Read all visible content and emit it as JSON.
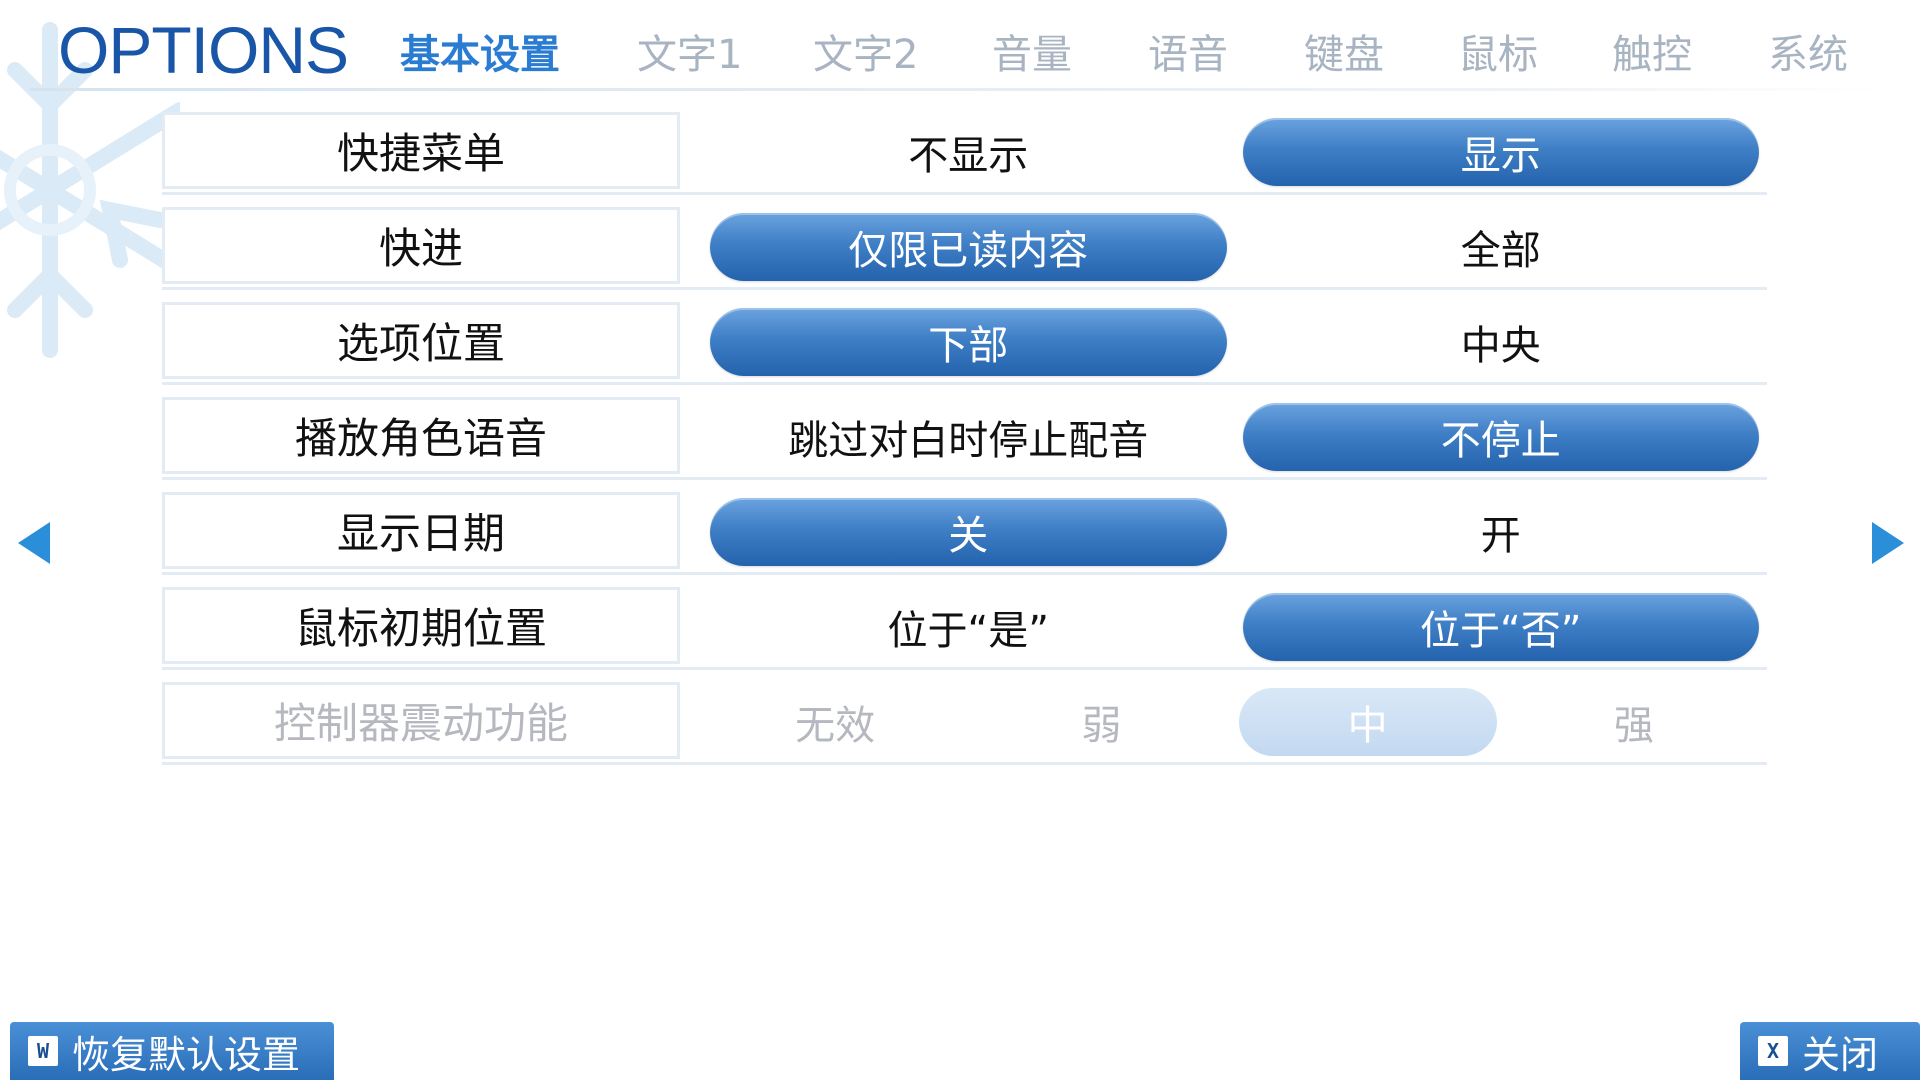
{
  "header": {
    "title": "OPTIONS",
    "tabs": [
      "基本设置",
      "文字1",
      "文字2",
      "音量",
      "语音",
      "键盘",
      "鼠标",
      "触控",
      "系统"
    ],
    "active_tab": "基本设置"
  },
  "settings": [
    {
      "label": "快捷菜单",
      "options": [
        "不显示",
        "显示"
      ],
      "selected": "显示"
    },
    {
      "label": "快进",
      "options": [
        "仅限已读内容",
        "全部"
      ],
      "selected": "仅限已读内容"
    },
    {
      "label": "选项位置",
      "options": [
        "下部",
        "中央"
      ],
      "selected": "下部"
    },
    {
      "label": "播放角色语音",
      "options": [
        "跳过对白时停止配音",
        "不停止"
      ],
      "selected": "不停止"
    },
    {
      "label": "显示日期",
      "options": [
        "关",
        "开"
      ],
      "selected": "关"
    },
    {
      "label": "鼠标初期位置",
      "options": [
        "位于“是”",
        "位于“否”"
      ],
      "selected": "位于“否”"
    },
    {
      "label": "控制器震动功能",
      "options": [
        "无效",
        "弱",
        "中",
        "强"
      ],
      "selected": "中",
      "disabled": true
    }
  ],
  "footer": {
    "reset_key": "W",
    "reset_label": "恢复默认设置",
    "close_key": "X",
    "close_label": "关闭"
  },
  "colors": {
    "accent": "#2a7cd3",
    "title": "#1a56a8",
    "button": "#2463ad"
  }
}
